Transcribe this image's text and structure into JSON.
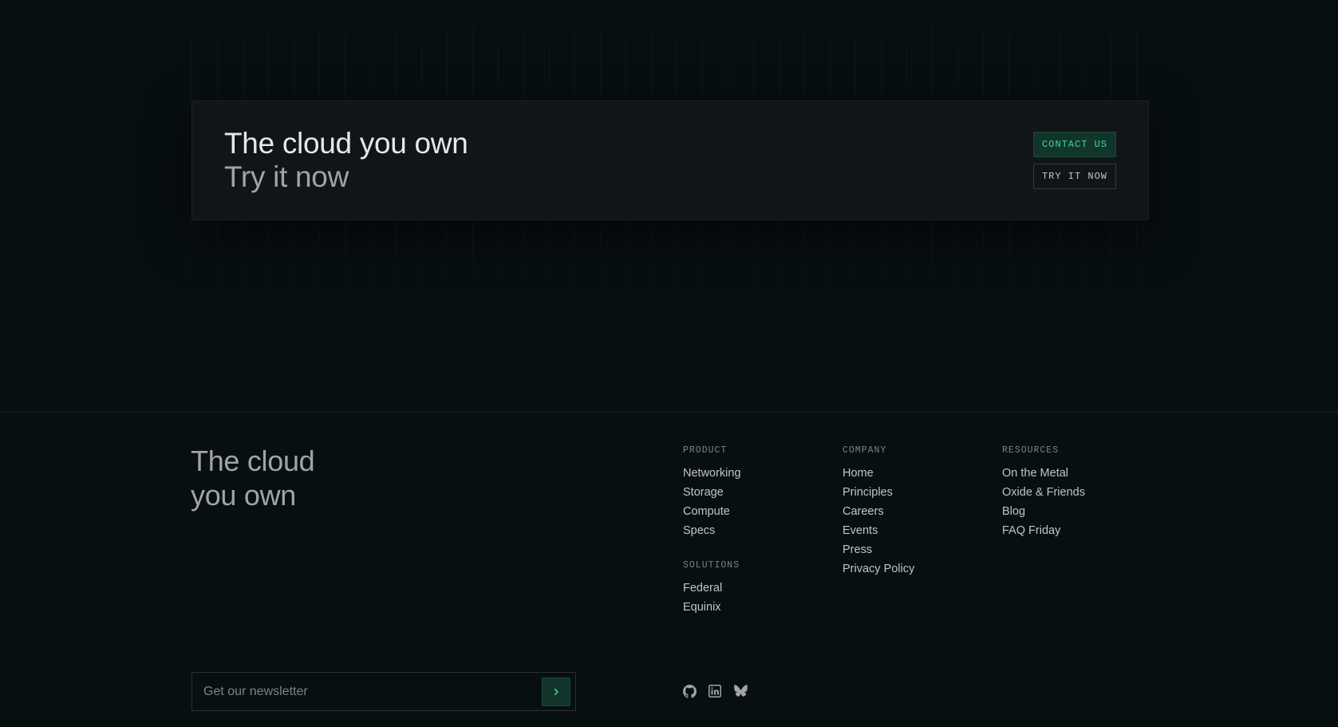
{
  "cta": {
    "title": "The cloud you own",
    "subtitle": "Try it now",
    "contact_label": "CONTACT US",
    "try_label": "TRY IT NOW"
  },
  "footer": {
    "brand_line1": "The cloud",
    "brand_line2": "you own",
    "product": {
      "heading": "PRODUCT",
      "links": [
        "Networking",
        "Storage",
        "Compute",
        "Specs"
      ]
    },
    "solutions": {
      "heading": "SOLUTIONS",
      "links": [
        "Federal",
        "Equinix"
      ]
    },
    "company": {
      "heading": "COMPANY",
      "links": [
        "Home",
        "Principles",
        "Careers",
        "Events",
        "Press",
        "Privacy Policy"
      ]
    },
    "resources": {
      "heading": "RESOURCES",
      "links": [
        "On the Metal",
        "Oxide & Friends",
        "Blog",
        "FAQ Friday"
      ]
    },
    "newsletter": {
      "placeholder": "Get our newsletter",
      "submit_icon": "chevron-right-icon"
    },
    "socials": [
      "github-icon",
      "linkedin-icon",
      "bluesky-icon"
    ]
  },
  "colors": {
    "background": "#080f11",
    "card": "#101618",
    "accent": "#48d597",
    "accent_bg": "#12352b"
  }
}
